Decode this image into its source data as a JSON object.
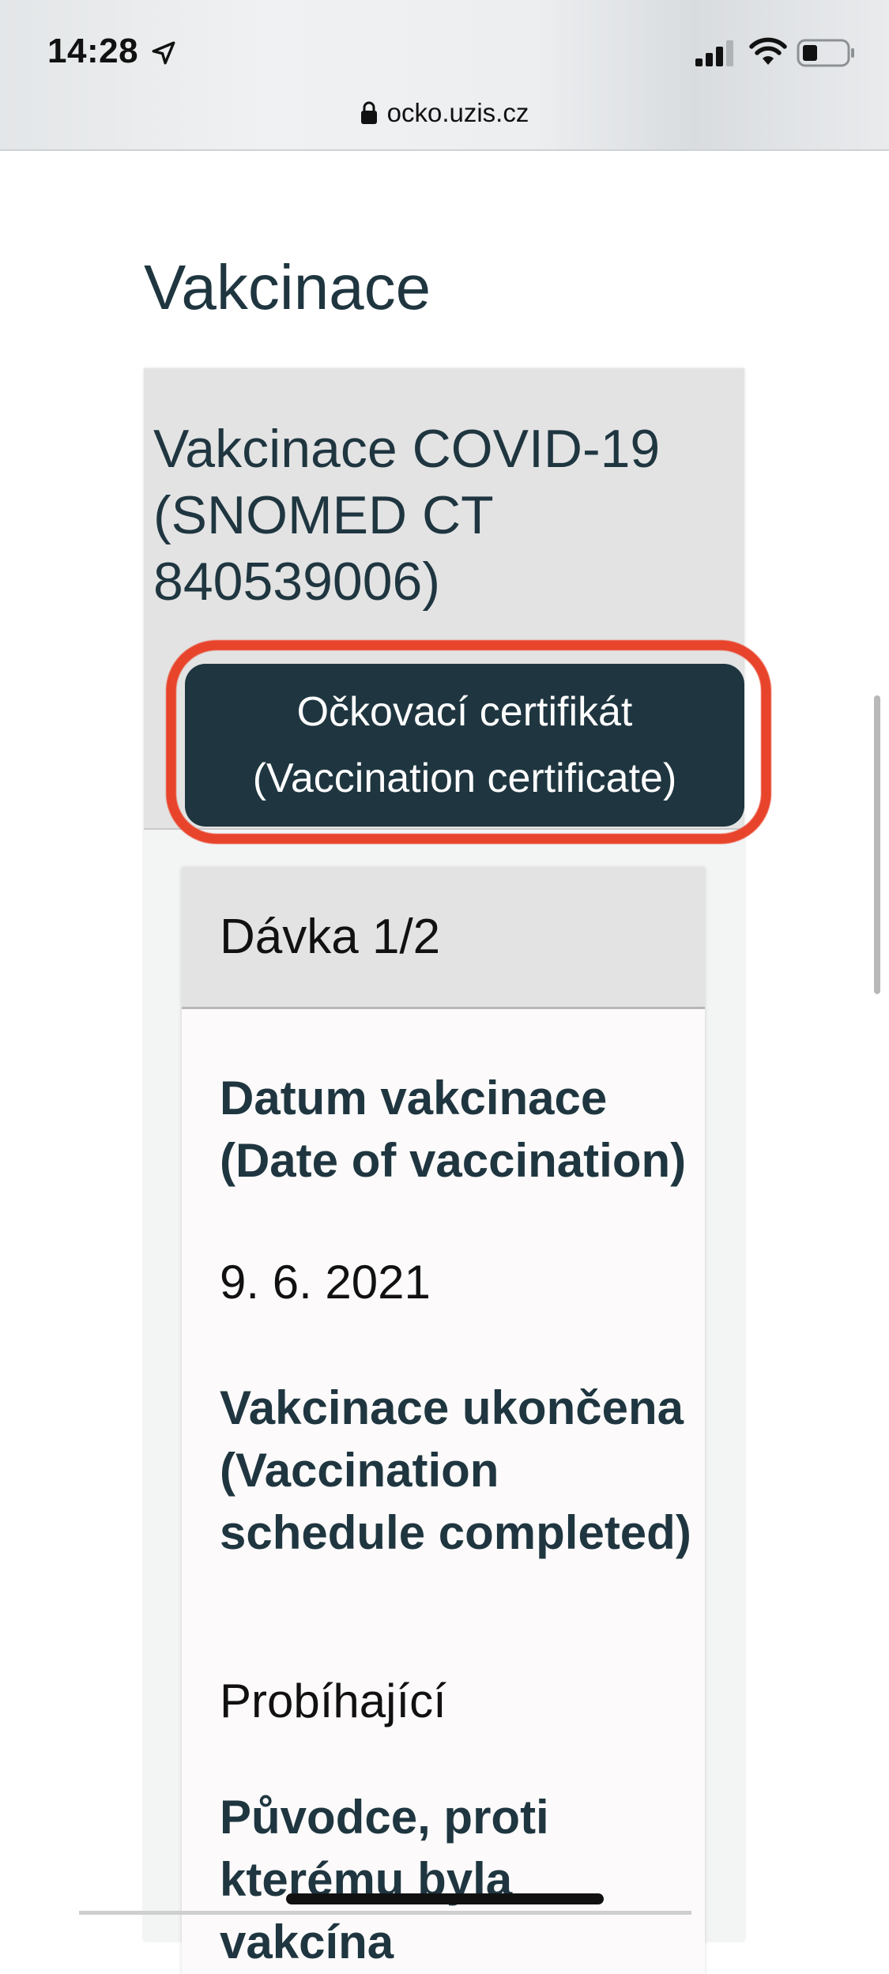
{
  "status_bar": {
    "time": "14:28",
    "icons": [
      "location-arrow-icon",
      "cellular-signal-icon",
      "wifi-icon",
      "battery-icon"
    ]
  },
  "browser": {
    "url": "ocko.uzis.cz",
    "lock_icon": "lock-icon"
  },
  "page": {
    "title": "Vakcinace"
  },
  "vaccination": {
    "name": "Vakcinace COVID-19 (SNOMED CT 840539006)",
    "certificate_button": {
      "line1": "Očkovací certifikát",
      "line2": "(Vaccination certificate)"
    },
    "dose": {
      "label": "Dávka 1/2",
      "fields": [
        {
          "label": "Datum vakcinace (Date of vaccination)",
          "value": "9. 6. 2021"
        },
        {
          "label": "Vakcinace ukončena (Vaccination schedule completed)",
          "value": "Probíhající"
        },
        {
          "label": "Původce, proti kterému byla vakcína",
          "value": ""
        }
      ]
    }
  },
  "colors": {
    "primary_dark": "#1f3640",
    "highlight_annotation": "#e8442c",
    "card_header_bg": "#e3e3e3"
  }
}
